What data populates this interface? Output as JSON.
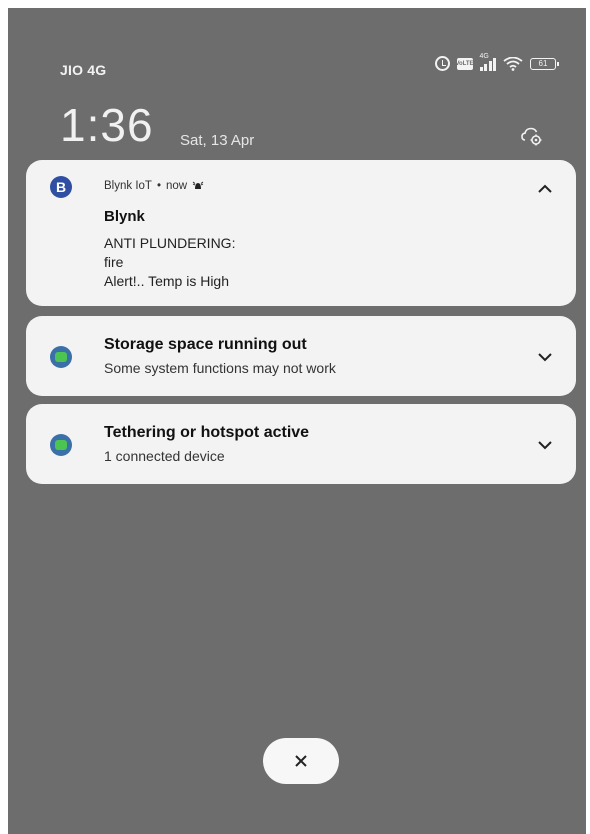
{
  "status_bar": {
    "carrier": "JIO 4G",
    "network_tag": "4G",
    "volte_label": "VoLTE",
    "battery": "61",
    "icons": [
      "alarm-icon",
      "volte-icon",
      "signal-icon",
      "wifi-icon",
      "battery-icon"
    ]
  },
  "clock": {
    "time": "1:36",
    "date": "Sat, 13 Apr",
    "settings_icon": "gear-cloud-icon"
  },
  "notifications": [
    {
      "app": "Blynk IoT",
      "separator": "•",
      "time": "now",
      "title": "Blynk",
      "lines": [
        "ANTI PLUNDERING:",
        "fire",
        "Alert!.. Temp is High"
      ],
      "logo": "B",
      "expanded": true
    },
    {
      "title": "Storage space running out",
      "subtitle": "Some system functions may not work",
      "expanded": false
    },
    {
      "title": "Tethering or hotspot active",
      "subtitle": "1 connected device",
      "expanded": false
    }
  ],
  "clear_button": {
    "icon": "close-icon",
    "label": "×"
  },
  "colors": {
    "background": "#6d6d6d",
    "card": "#f3f3f3",
    "blynk_logo": "#2f4fa2",
    "system_icon_green": "#4cc452"
  }
}
